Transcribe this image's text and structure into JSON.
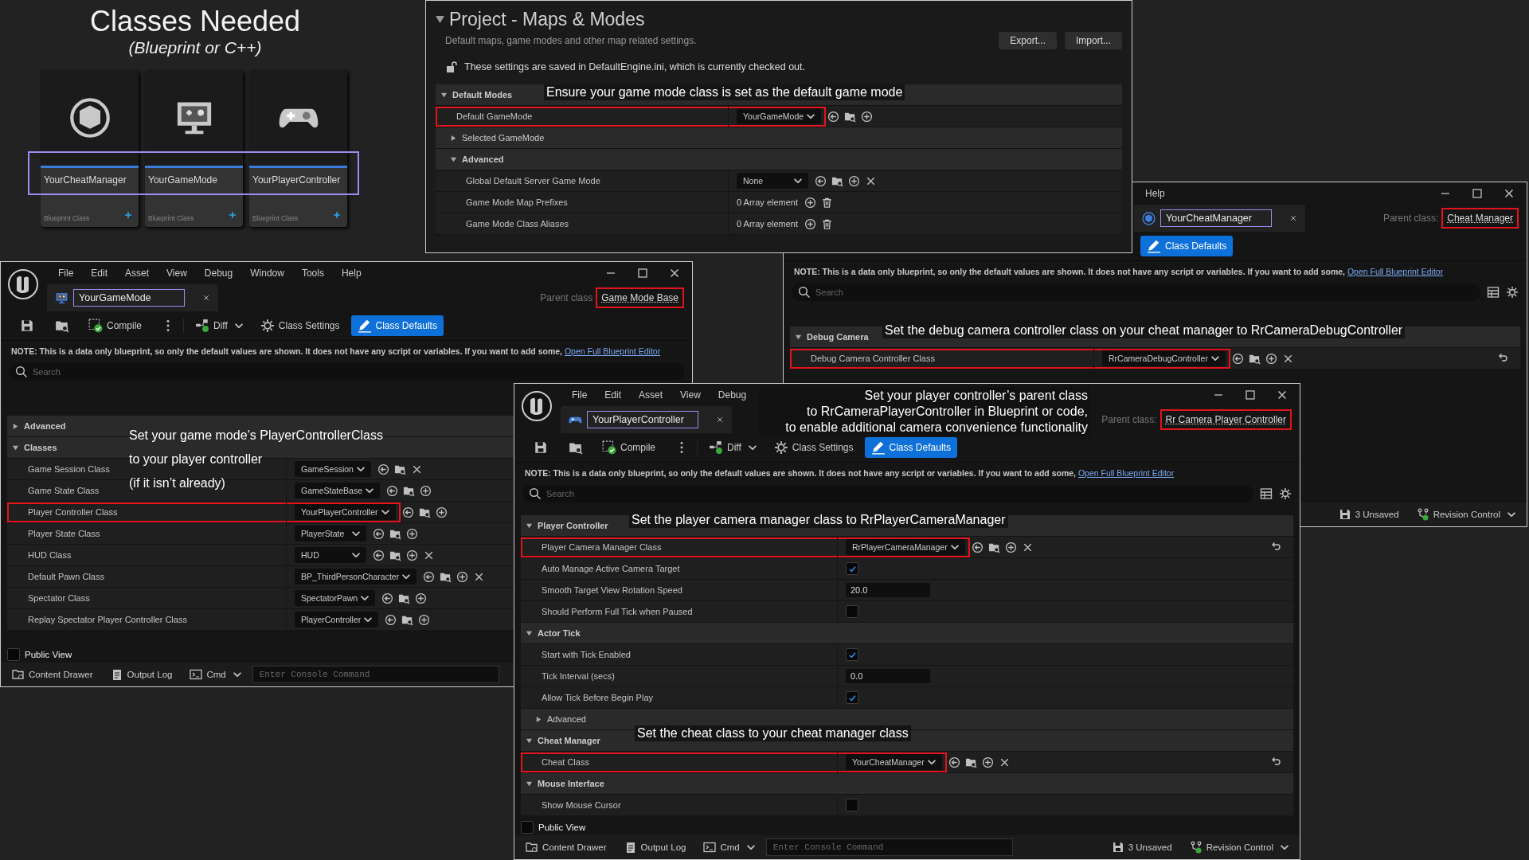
{
  "intro": {
    "title": "Classes Needed",
    "subtitle": "(Blueprint or C++)",
    "names_highlighted": true,
    "cards": [
      {
        "name": "YourCheatManager",
        "type": "Blueprint Class"
      },
      {
        "name": "YourGameMode",
        "type": "Blueprint Class"
      },
      {
        "name": "YourPlayerController",
        "type": "Blueprint Class"
      }
    ]
  },
  "project_settings": {
    "title": "Project - Maps & Modes",
    "description": "Default maps, game modes and other map related settings.",
    "buttons": [
      "Export...",
      "Import..."
    ],
    "notice": "These settings are saved in DefaultEngine.ini, which is currently checked out.",
    "rows": [
      {
        "kind": "category",
        "label": "Default Modes",
        "expanded": true,
        "children": [
          {
            "kind": "class",
            "label": "Default GameMode",
            "value": "YourGameMode",
            "icons": [
              {
                "kind": "use"
              },
              {
                "kind": "browse"
              },
              {
                "kind": "add"
              }
            ],
            "highlighted": true
          },
          {
            "kind": "category",
            "label": "Selected GameMode",
            "expanded": false
          },
          {
            "kind": "category",
            "label": "Advanced",
            "expanded": true,
            "children": [
              {
                "kind": "class",
                "label": "Global Default Server Game Mode",
                "value": "None",
                "icons": [
                  {
                    "kind": "use"
                  },
                  {
                    "kind": "browse"
                  },
                  {
                    "kind": "add"
                  },
                  {
                    "kind": "clear"
                  }
                ],
                "highlighted": false
              },
              {
                "kind": "array",
                "label": "Game Mode Map Prefixes",
                "value": "0 Array element",
                "icons": [
                  {
                    "kind": "add"
                  },
                  {
                    "kind": "delete"
                  }
                ],
                "highlighted": false
              },
              {
                "kind": "array",
                "label": "Game Mode Class Aliases",
                "value": "0 Array element",
                "icons": [
                  {
                    "kind": "add"
                  },
                  {
                    "kind": "delete"
                  }
                ],
                "highlighted": false
              }
            ]
          }
        ]
      }
    ]
  },
  "windows": [
    {
      "menu": [
        "File",
        "Edit",
        "Asset",
        "View",
        "Debug",
        "Window",
        "Tools",
        "Help"
      ],
      "tab": {
        "label": "YourGameMode",
        "highlighted": true
      },
      "parent_class": {
        "label": "Parent class",
        "value": "Game Mode Base",
        "highlighted": true
      },
      "toolbar": [
        {
          "kind": "save"
        },
        {
          "kind": "browse"
        },
        {
          "kind": "compile",
          "label": "Compile"
        },
        {
          "kind": "more"
        },
        {
          "kind": "diff",
          "label": "Diff"
        },
        {
          "kind": "settings",
          "label": "Class Settings",
          "selected": false
        },
        {
          "kind": "defaults",
          "label": "Class Defaults",
          "selected": true
        }
      ],
      "note": {
        "text": "NOTE: This is a data only blueprint, so only the default values are shown.  It does not have any script or variables.  If you want to add some,",
        "link": "Open Full Blueprint Editor"
      },
      "search": {
        "placeholder": "Search"
      },
      "rows": [
        {
          "kind": "category",
          "label": "Advanced",
          "expanded": false
        },
        {
          "kind": "category",
          "label": "Classes",
          "expanded": true,
          "children": [
            {
              "kind": "class",
              "label": "Game Session Class",
              "value": "GameSession",
              "icons": [
                {
                  "kind": "use"
                },
                {
                  "kind": "browse"
                },
                {
                  "kind": "clear"
                }
              ],
              "highlighted": false
            },
            {
              "kind": "class",
              "label": "Game State Class",
              "value": "GameStateBase",
              "icons": [
                {
                  "kind": "use"
                },
                {
                  "kind": "browse"
                },
                {
                  "kind": "add"
                }
              ],
              "highlighted": false
            },
            {
              "kind": "class",
              "label": "Player Controller Class",
              "value": "YourPlayerController",
              "icons": [
                {
                  "kind": "use"
                },
                {
                  "kind": "browse"
                },
                {
                  "kind": "add"
                }
              ],
              "highlighted": true
            },
            {
              "kind": "class",
              "label": "Player State Class",
              "value": "PlayerState",
              "icons": [
                {
                  "kind": "use"
                },
                {
                  "kind": "browse"
                },
                {
                  "kind": "add"
                }
              ],
              "highlighted": false
            },
            {
              "kind": "class",
              "label": "HUD Class",
              "value": "HUD",
              "icons": [
                {
                  "kind": "use"
                },
                {
                  "kind": "browse"
                },
                {
                  "kind": "add"
                },
                {
                  "kind": "clear"
                }
              ],
              "highlighted": false
            },
            {
              "kind": "class",
              "label": "Default Pawn Class",
              "value": "BP_ThirdPersonCharacter",
              "icons": [
                {
                  "kind": "use"
                },
                {
                  "kind": "browse"
                },
                {
                  "kind": "add"
                },
                {
                  "kind": "clear"
                }
              ],
              "highlighted": false
            },
            {
              "kind": "class",
              "label": "Spectator Class",
              "value": "SpectatorPawn",
              "icons": [
                {
                  "kind": "use"
                },
                {
                  "kind": "browse"
                },
                {
                  "kind": "add"
                }
              ],
              "highlighted": false
            },
            {
              "kind": "class",
              "label": "Replay Spectator Player Controller Class",
              "value": "PlayerController",
              "icons": [
                {
                  "kind": "use"
                },
                {
                  "kind": "browse"
                },
                {
                  "kind": "add"
                }
              ],
              "highlighted": false
            }
          ]
        }
      ],
      "public_view": {
        "label": "Public View",
        "checked": false
      },
      "status_bar": [
        {
          "kind": "drawer",
          "label": "Content Drawer"
        },
        {
          "kind": "log",
          "label": "Output Log"
        },
        {
          "kind": "cmd",
          "label": "Cmd"
        },
        {
          "kind": "console",
          "placeholder": "Enter Console Command"
        }
      ]
    },
    {
      "menu": [
        "Help"
      ],
      "tab": {
        "label": "YourCheatManager",
        "highlighted": true
      },
      "parent_class": {
        "label": "Parent class:",
        "value": "Cheat Manager",
        "highlighted": true
      },
      "toolbar": [
        {
          "kind": "defaults",
          "label": "Class Defaults",
          "selected": true
        }
      ],
      "note": {
        "text": "NOTE: This is a data only blueprint, so only the default values are shown.  It does not have any script or variables.  If you want to add some,",
        "link": "Open Full Blueprint Editor"
      },
      "search": {
        "placeholder": "Search"
      },
      "rows": [
        {
          "kind": "category",
          "label": "Debug Camera",
          "expanded": true,
          "children": [
            {
              "kind": "class",
              "label": "Debug Camera Controller Class",
              "value": "RrCameraDebugController",
              "icons": [
                {
                  "kind": "use"
                },
                {
                  "kind": "browse"
                },
                {
                  "kind": "add"
                },
                {
                  "kind": "clear"
                }
              ],
              "highlighted": true,
              "reset": true
            }
          ]
        }
      ],
      "status_bar": [
        {
          "kind": "unsaved",
          "label": "3 Unsaved"
        },
        {
          "kind": "revision",
          "label": "Revision Control"
        }
      ]
    },
    {
      "menu": [
        "File",
        "Edit",
        "Asset",
        "View",
        "Debug"
      ],
      "tab": {
        "label": "YourPlayerController",
        "highlighted": true
      },
      "parent_class": {
        "label": "Parent class:",
        "value": "Rr Camera Player Controller",
        "highlighted": true
      },
      "toolbar": [
        {
          "kind": "save"
        },
        {
          "kind": "browse"
        },
        {
          "kind": "compile",
          "label": "Compile"
        },
        {
          "kind": "more"
        },
        {
          "kind": "diff",
          "label": "Diff"
        },
        {
          "kind": "settings",
          "label": "Class Settings",
          "selected": false
        },
        {
          "kind": "defaults",
          "label": "Class Defaults",
          "selected": true
        }
      ],
      "note": {
        "text": "NOTE: This is a data only blueprint, so only the default values are shown.  It does not have any script or variables.  If you want to add some,",
        "link": "Open Full Blueprint Editor"
      },
      "search": {
        "placeholder": "Search"
      },
      "rows": [
        {
          "kind": "category",
          "label": "Player Controller",
          "expanded": true,
          "children": [
            {
              "kind": "class",
              "label": "Player Camera Manager Class",
              "value": "RrPlayerCameraManager",
              "icons": [
                {
                  "kind": "use"
                },
                {
                  "kind": "browse"
                },
                {
                  "kind": "add"
                },
                {
                  "kind": "clear"
                }
              ],
              "highlighted": true,
              "reset": true
            },
            {
              "kind": "check",
              "label": "Auto Manage Active Camera Target",
              "checked": true,
              "highlighted": false
            },
            {
              "kind": "number",
              "label": "Smooth Target View Rotation Speed",
              "value": "20.0",
              "highlighted": false
            },
            {
              "kind": "check",
              "label": "Should Perform Full Tick when Paused",
              "checked": false,
              "highlighted": false
            }
          ]
        },
        {
          "kind": "category",
          "label": "Actor Tick",
          "expanded": true,
          "children": [
            {
              "kind": "check",
              "label": "Start with Tick Enabled",
              "checked": true,
              "highlighted": false
            },
            {
              "kind": "number",
              "label": "Tick Interval (secs)",
              "value": "0.0",
              "highlighted": false
            },
            {
              "kind": "check",
              "label": "Allow Tick Before Begin Play",
              "checked": true,
              "highlighted": false
            },
            {
              "kind": "category",
              "label": "Advanced",
              "expanded": false
            }
          ]
        },
        {
          "kind": "category",
          "label": "Cheat Manager",
          "expanded": true,
          "children": [
            {
              "kind": "class",
              "label": "Cheat Class",
              "value": "YourCheatManager",
              "icons": [
                {
                  "kind": "use"
                },
                {
                  "kind": "browse"
                },
                {
                  "kind": "add"
                },
                {
                  "kind": "clear"
                }
              ],
              "highlighted": true,
              "reset": true
            }
          ]
        },
        {
          "kind": "category",
          "label": "Mouse Interface",
          "expanded": true,
          "children": [
            {
              "kind": "check",
              "label": "Show Mouse Cursor",
              "checked": false,
              "highlighted": false
            }
          ]
        }
      ],
      "public_view": {
        "label": "Public View",
        "checked": false
      },
      "status_bar": [
        {
          "kind": "drawer",
          "label": "Content Drawer"
        },
        {
          "kind": "log",
          "label": "Output Log"
        },
        {
          "kind": "cmd",
          "label": "Cmd"
        },
        {
          "kind": "console",
          "placeholder": "Enter Console Command"
        },
        {
          "kind": "unsaved",
          "label": "3 Unsaved"
        },
        {
          "kind": "revision",
          "label": "Revision Control"
        }
      ]
    }
  ],
  "annotations": [
    {
      "lines": [
        "Ensure your game mode class is set as the default game mode"
      ]
    },
    {
      "lines": [
        "Set your game mode’s PlayerControllerClass",
        "to your player controller",
        "(if it isn’t already)"
      ]
    },
    {
      "lines": [
        "Set the debug camera controller class on your cheat manager to RrCameraDebugController"
      ]
    },
    {
      "lines": [
        "Set your player controller’s parent class",
        "to RrCameraPlayerController in Blueprint or code,",
        "to enable additional camera convenience functionality"
      ]
    },
    {
      "lines": [
        "Set the player camera manager class to RrPlayerCameraManager"
      ]
    },
    {
      "lines": [
        "Set the cheat class to your cheat manager class"
      ]
    }
  ]
}
